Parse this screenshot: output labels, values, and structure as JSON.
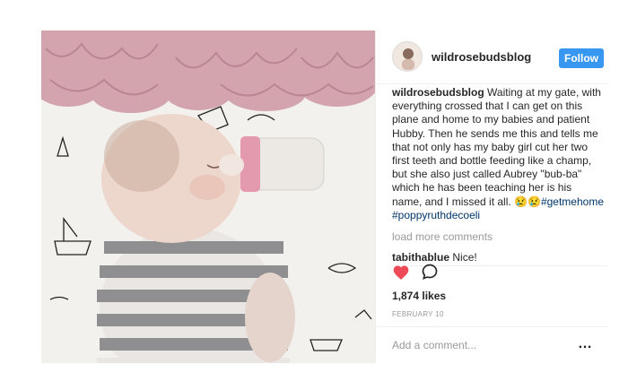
{
  "post": {
    "username": "wildrosebudsblog",
    "follow_label": "Follow",
    "caption": {
      "author": "wildrosebudsblog",
      "text": "Waiting at my gate, with everything crossed that I can get on this plane and home to my babies and patient Hubby. Then he sends me this and tells me that not only has my baby girl cut her two first teeth and bottle feeding like a champ, but she also just called Aubrey \"bub-ba\" which he has been teaching her is his name, and I missed it all. 😢😢",
      "hashtag1": "#getmehome",
      "hashtag2": "#poppyruthdecoeli"
    },
    "load_more": "load more comments",
    "comment": {
      "author": "tabithablue",
      "text": "Nice!"
    },
    "likes": "1,874 likes",
    "date": "FEBRUARY 10",
    "add_comment_placeholder": "Add a comment...",
    "more_label": "…"
  },
  "colors": {
    "follow_bg": "#3897f0",
    "heart": "#ed4956",
    "hashtag": "#003569",
    "muted": "#999999"
  },
  "icons": [
    "heart-icon",
    "comment-icon",
    "more-options-icon"
  ]
}
